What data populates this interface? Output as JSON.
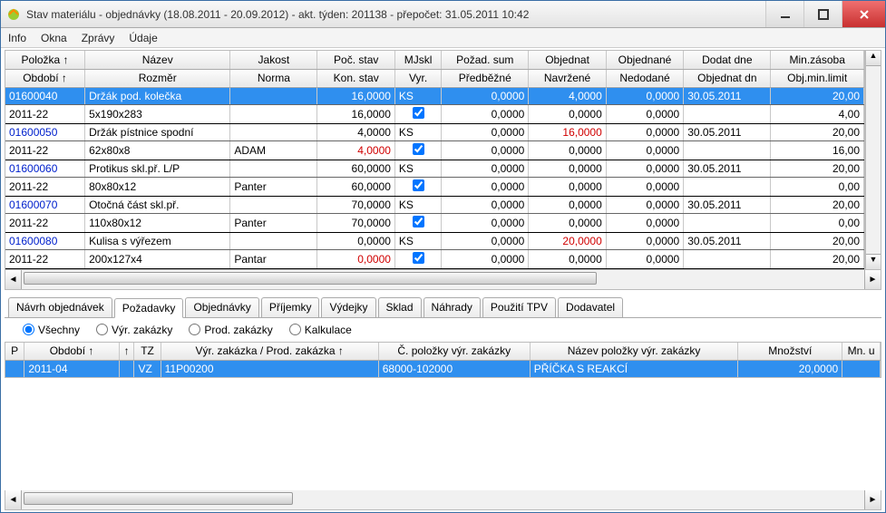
{
  "title": "Stav materiálu - objednávky (18.08.2011 - 20.09.2012) - akt. týden: 201138 - přepočet: 31.05.2011 10:42",
  "menu": [
    "Info",
    "Okna",
    "Zprávy",
    "Údaje"
  ],
  "top_headers_row1": [
    "Položka ↑",
    "Název",
    "Jakost",
    "Poč. stav",
    "MJskl",
    "Požad. sum",
    "Objednat",
    "Objednané",
    "Dodat dne",
    "Min.zásoba"
  ],
  "top_headers_row2": [
    "Období ↑",
    "Rozměr",
    "Norma",
    "Kon. stav",
    "Vyr.",
    "Předběžné",
    "Navržené",
    "Nedodané",
    "Objednat dn",
    "Obj.min.limit"
  ],
  "rows": [
    {
      "r1": [
        "01600040",
        "Držák pod. kolečka",
        "",
        "16,0000",
        "KS",
        "0,0000",
        "4,0000",
        "0,0000",
        "30.05.2011",
        "20,00"
      ],
      "r2": [
        "2011-22",
        "5x190x283",
        "",
        "16,0000",
        "☑",
        "0,0000",
        "0,0000",
        "0,0000",
        "",
        "4,00"
      ],
      "sel": true
    },
    {
      "r1": [
        "01600050",
        "Držák pístnice spodní",
        "",
        "4,0000",
        "KS",
        "0,0000",
        "16,0000",
        "0,0000",
        "30.05.2011",
        "20,00"
      ],
      "r2": [
        "2011-22",
        "62x80x8",
        "ADAM",
        "4,0000",
        "☑",
        "0,0000",
        "0,0000",
        "0,0000",
        "",
        "16,00"
      ],
      "red1": [
        6
      ],
      "red2": [
        3
      ]
    },
    {
      "r1": [
        "01600060",
        "Protikus skl.př. L/P",
        "",
        "60,0000",
        "KS",
        "0,0000",
        "0,0000",
        "0,0000",
        "30.05.2011",
        "20,00"
      ],
      "r2": [
        "2011-22",
        "80x80x12",
        "Panter",
        "60,0000",
        "☑",
        "0,0000",
        "0,0000",
        "0,0000",
        "",
        "0,00"
      ]
    },
    {
      "r1": [
        "01600070",
        "Otočná část skl.př.",
        "",
        "70,0000",
        "KS",
        "0,0000",
        "0,0000",
        "0,0000",
        "30.05.2011",
        "20,00"
      ],
      "r2": [
        "2011-22",
        "110x80x12",
        "Panter",
        "70,0000",
        "☑",
        "0,0000",
        "0,0000",
        "0,0000",
        "",
        "0,00"
      ]
    },
    {
      "r1": [
        "01600080",
        "Kulisa s výřezem",
        "",
        "0,0000",
        "KS",
        "0,0000",
        "20,0000",
        "0,0000",
        "30.05.2011",
        "20,00"
      ],
      "r2": [
        "2011-22",
        "200x127x4",
        "Pantar",
        "0,0000",
        "☑",
        "0,0000",
        "0,0000",
        "0,0000",
        "",
        "20,00"
      ],
      "red1": [
        6
      ],
      "red2": [
        3
      ]
    }
  ],
  "tabs": [
    "Návrh objednávek",
    "Požadavky",
    "Objednávky",
    "Příjemky",
    "Výdejky",
    "Sklad",
    "Náhrady",
    "Použití TPV",
    "Dodavatel"
  ],
  "active_tab": 1,
  "radios": [
    "Všechny",
    "Výr. zakázky",
    "Prod. zakázky",
    "Kalkulace"
  ],
  "radio_sel": 0,
  "bottom_headers": [
    "P",
    "Období   ↑",
    "↑",
    "TZ",
    "Výr. zakázka / Prod. zakázka ↑",
    "Č. položky výr. zakázky",
    "Název položky výr. zakázky",
    "Množství",
    "Mn. u"
  ],
  "bottom_row": [
    "",
    "2011-04",
    "",
    "VZ",
    "11P00200",
    "68000-102000",
    "PŘÍČKA S REAKCÍ",
    "20,0000",
    ""
  ]
}
